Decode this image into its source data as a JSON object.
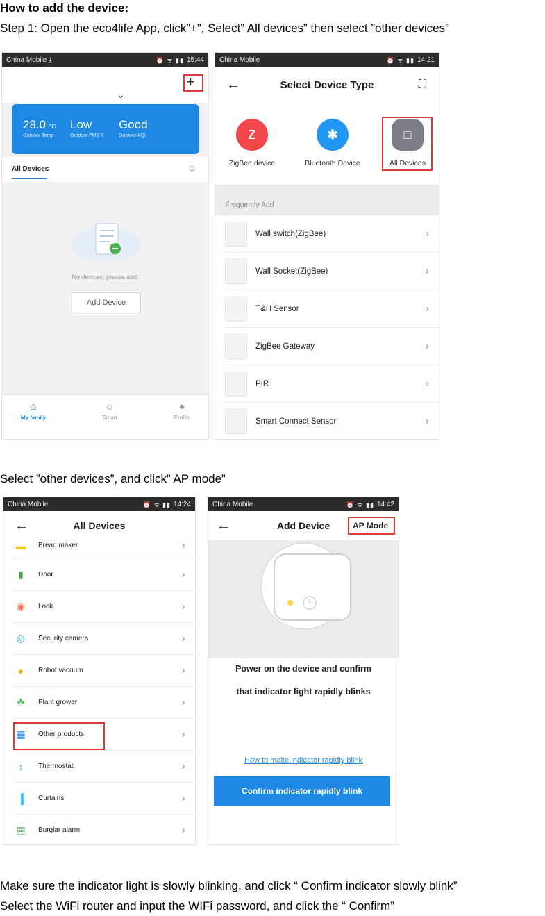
{
  "doc": {
    "title": "How to add the device:",
    "step1": "Step 1: Open the eco4life App, click”+”, Select” All devices” then select ”other devices”",
    "step2": "Select ”other devices”, and click” AP mode”",
    "step3": "Make sure the indicator light is slowly blinking, and click “ Confirm indicator slowly blink”",
    "step4": "Select the WiFi router and input the WIFi password, and click the “ Confirm”"
  },
  "screen1": {
    "carrier": "China Mobile ⤓",
    "time": "15:44",
    "dropdown": "⌄",
    "plus": "+",
    "weather": [
      {
        "value": "28.0",
        "unit": "°C",
        "label": "Outdoor Temp"
      },
      {
        "value": "Low",
        "unit": "",
        "label": "Outdoor PM2.5"
      },
      {
        "value": "Good",
        "unit": "",
        "label": "Outdoor AQI"
      }
    ],
    "tab": "All Devices",
    "empty_text": "No devices, please add.",
    "add_button": "Add Device",
    "nav": [
      {
        "label": "My family",
        "icon": "home-icon"
      },
      {
        "label": "Smart",
        "icon": "sun-icon"
      },
      {
        "label": "Profile",
        "icon": "profile-icon"
      }
    ]
  },
  "screen2": {
    "carrier": "China Mobile",
    "time": "14:21",
    "title": "Select Device Type",
    "types": [
      {
        "label": "ZigBee device",
        "color": "#f0474a",
        "glyph": "Z"
      },
      {
        "label": "Bluetooth Device",
        "color": "#2196f3",
        "glyph": "✱"
      },
      {
        "label": "All Devices",
        "color": "#7d7d86",
        "glyph": "□"
      }
    ],
    "section": "Frequently Add",
    "items": [
      "Wall switch(ZigBee)",
      "Wall Socket(ZigBee)",
      "T&H Sensor",
      "ZigBee Gateway",
      "PIR",
      "Smart Connect Sensor"
    ]
  },
  "screen3": {
    "carrier": "China Mobile",
    "time": "14:24",
    "title": "All Devices",
    "items": [
      {
        "label": "Bread maker",
        "color": "#f5c518",
        "glyph": "▬"
      },
      {
        "label": "Door",
        "color": "#43a047",
        "glyph": "▮"
      },
      {
        "label": "Lock",
        "color": "#ff7043",
        "glyph": "◉"
      },
      {
        "label": "Security camera",
        "color": "#29b6f6",
        "glyph": "◎"
      },
      {
        "label": "Robot vacuum",
        "color": "#ffb300",
        "glyph": "●"
      },
      {
        "label": "Plant grower",
        "color": "#66bb6a",
        "glyph": "☘"
      },
      {
        "label": "Other products",
        "color": "#1e88e5",
        "glyph": "▦"
      },
      {
        "label": "Thermostat",
        "color": "#29b6f6",
        "glyph": "↕"
      },
      {
        "label": "Curtains",
        "color": "#4fc3f7",
        "glyph": "▐"
      },
      {
        "label": "Burglar alarm",
        "color": "#66bb6a",
        "glyph": "▤"
      }
    ]
  },
  "screen4": {
    "carrier": "China Mobile",
    "time": "14:42",
    "title": "Add Device",
    "ap_mode": "AP Mode",
    "instruction_line1": "Power on the device and confirm",
    "instruction_line2": "that indicator light rapidly blinks",
    "howto_link": "How to make indicator rapidly blink",
    "confirm_button": "Confirm indicator rapidly blink"
  },
  "colors": {
    "accent": "#1e88e5",
    "highlight": "#e53935"
  }
}
